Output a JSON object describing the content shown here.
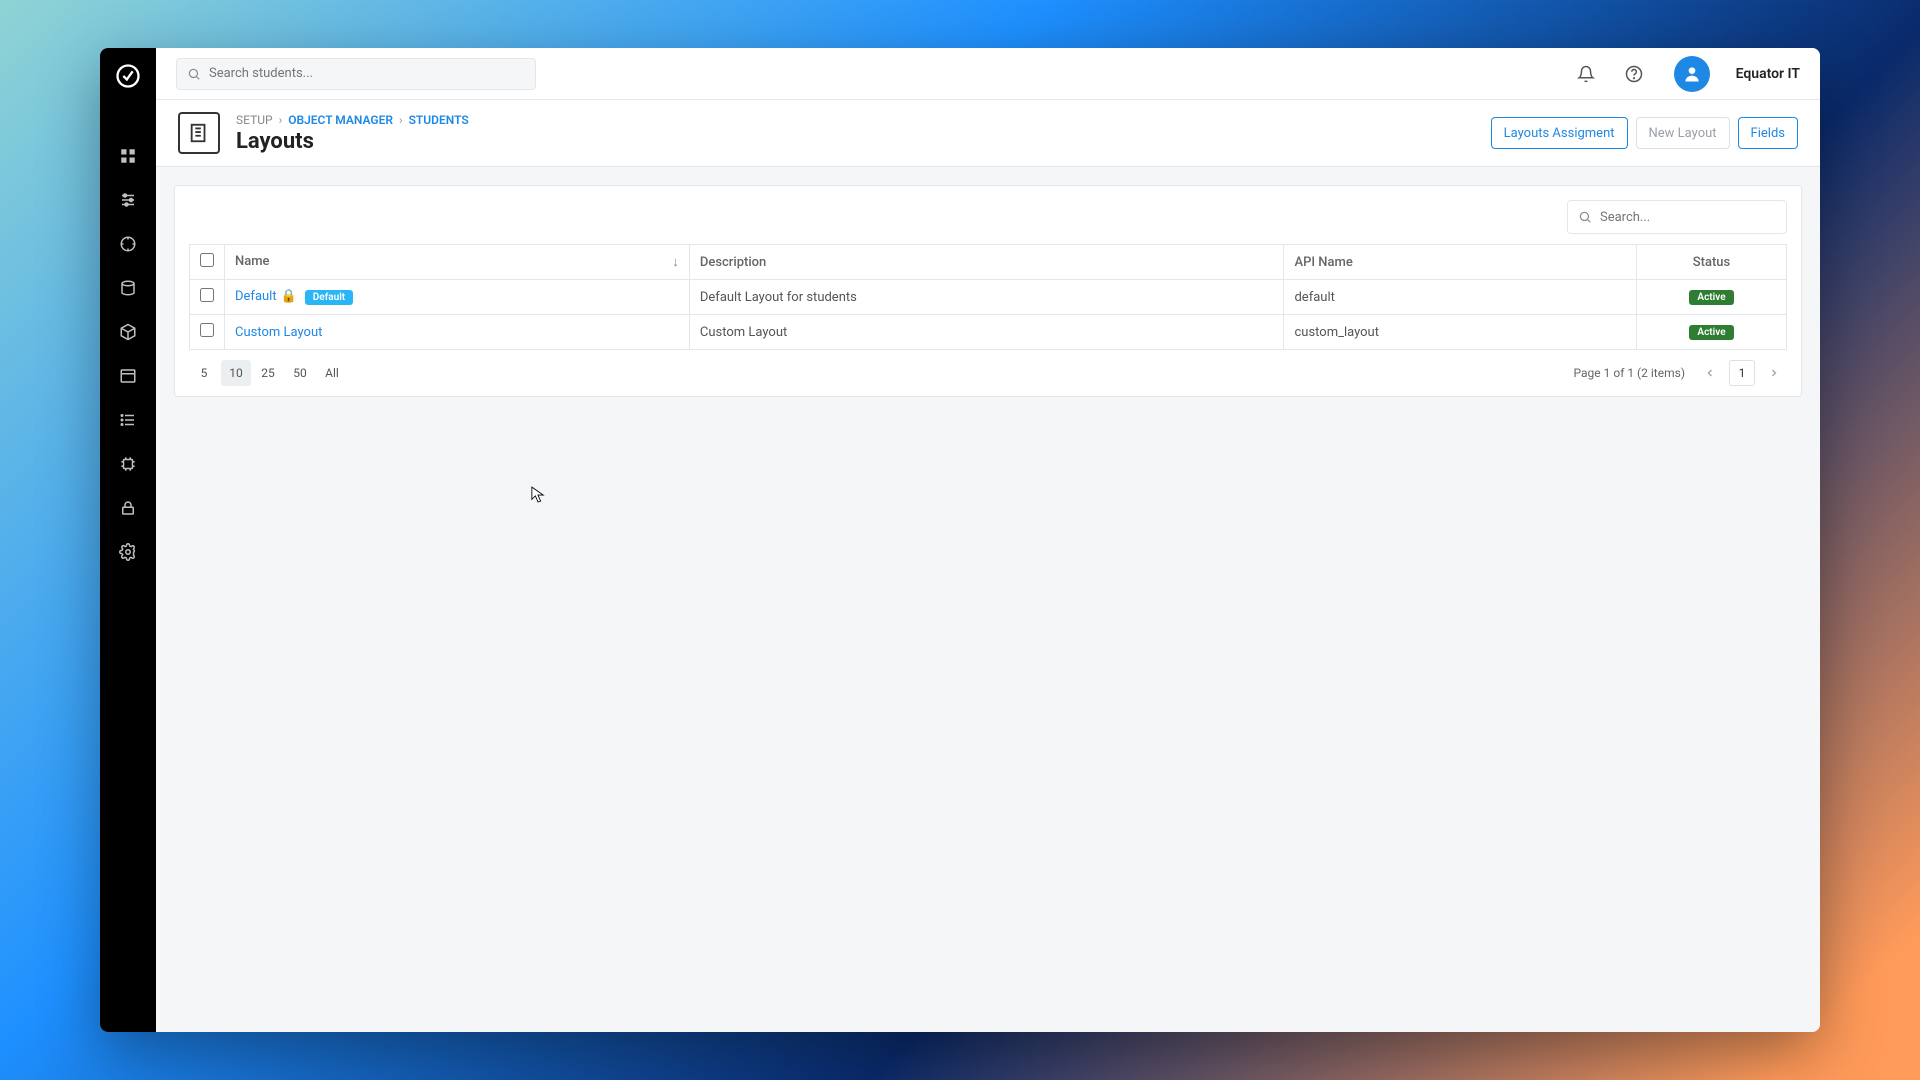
{
  "header": {
    "search_placeholder": "Search students...",
    "username": "Equator IT"
  },
  "breadcrumb": {
    "root": "SETUP",
    "l1": "OBJECT MANAGER",
    "l2": "STUDENTS"
  },
  "page": {
    "title": "Layouts",
    "actions": {
      "layouts_assignment": "Layouts Assigment",
      "new_layout": "New Layout",
      "fields": "Fields"
    }
  },
  "table": {
    "search_placeholder": "Search...",
    "columns": {
      "name": "Name",
      "description": "Description",
      "api_name": "API Name",
      "status": "Status"
    },
    "rows": [
      {
        "name": "Default",
        "locked": true,
        "is_default": true,
        "default_badge": "Default",
        "description": "Default Layout for students",
        "api_name": "default",
        "status": "Active"
      },
      {
        "name": "Custom Layout",
        "locked": false,
        "is_default": false,
        "default_badge": "",
        "description": "Custom Layout",
        "api_name": "custom_layout",
        "status": "Active"
      }
    ],
    "page_sizes": [
      "5",
      "10",
      "25",
      "50",
      "All"
    ],
    "active_page_size": "10",
    "page_info": "Page 1 of 1 (2 items)",
    "current_page": "1"
  }
}
